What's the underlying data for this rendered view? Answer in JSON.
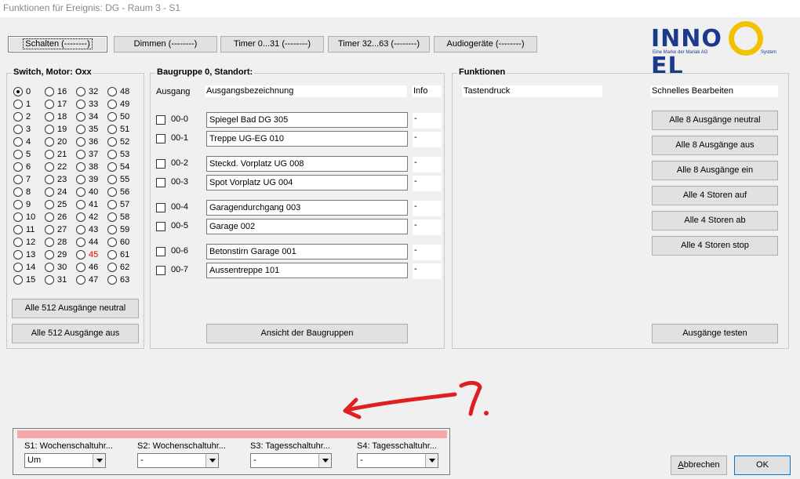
{
  "window": {
    "title": "Funktionen für Ereignis: DG - Raum 3 - S1"
  },
  "tabs": [
    {
      "label": "Schalten (--------)"
    },
    {
      "label": "Dimmen (--------)"
    },
    {
      "label": "Timer 0...31 (--------)"
    },
    {
      "label": "Timer 32...63 (--------)"
    },
    {
      "label": "Audiogeräte (--------)"
    }
  ],
  "logo": {
    "text_left": "INNO",
    "text_right": "EL",
    "tagline": "Eine Marke der Mariak AG",
    "system": "System",
    "colors": {
      "blue": "#1a3a8c",
      "yellow": "#f2c200"
    }
  },
  "switch_group": {
    "title": "Switch, Motor: Oxx",
    "selected": "0",
    "highlighted": "45",
    "columns": [
      [
        "0",
        "1",
        "2",
        "3",
        "4",
        "5",
        "6",
        "7",
        "8",
        "9",
        "10",
        "11",
        "12",
        "13",
        "14",
        "15"
      ],
      [
        "16",
        "17",
        "18",
        "19",
        "20",
        "21",
        "22",
        "23",
        "24",
        "25",
        "26",
        "27",
        "28",
        "29",
        "30",
        "31"
      ],
      [
        "32",
        "33",
        "34",
        "35",
        "36",
        "37",
        "38",
        "39",
        "40",
        "41",
        "42",
        "43",
        "44",
        "45",
        "46",
        "47"
      ],
      [
        "48",
        "49",
        "50",
        "51",
        "52",
        "53",
        "54",
        "55",
        "56",
        "57",
        "58",
        "59",
        "60",
        "61",
        "62",
        "63"
      ]
    ],
    "btn_neutral": "Alle 512 Ausgänge neutral",
    "btn_off": "Alle 512 Ausgänge aus"
  },
  "baugruppe": {
    "title": "Baugruppe 0, Standort:",
    "col_ausgang": "Ausgang",
    "col_bezeichnung": "Ausgangsbezeichnung",
    "col_info": "Info",
    "outputs": [
      {
        "id": "00-0",
        "name": "Spiegel Bad DG  305",
        "info": "-"
      },
      {
        "id": "00-1",
        "name": "Treppe UG-EG  010",
        "info": "-"
      },
      {
        "id": "00-2",
        "name": "Steckd. Vorplatz UG  008",
        "info": "-"
      },
      {
        "id": "00-3",
        "name": "Spot Vorplatz UG  004",
        "info": "-"
      },
      {
        "id": "00-4",
        "name": "Garagendurchgang  003",
        "info": "-"
      },
      {
        "id": "00-5",
        "name": "Garage  002",
        "info": "-"
      },
      {
        "id": "00-6",
        "name": "Betonstirn Garage  001",
        "info": "-"
      },
      {
        "id": "00-7",
        "name": "Aussentreppe  101",
        "info": "-"
      }
    ],
    "btn_view": "Ansicht der Baugruppen"
  },
  "funktionen": {
    "title": "Funktionen",
    "col_left": "Tastendruck",
    "col_right": "Schnelles Bearbeiten",
    "buttons": [
      "Alle 8 Ausgänge neutral",
      "Alle 8 Ausgänge aus",
      "Alle 8 Ausgänge ein",
      "Alle 4 Storen auf",
      "Alle 4 Storen ab",
      "Alle 4 Storen stop"
    ],
    "btn_test": "Ausgänge testen"
  },
  "schedules": [
    {
      "label": "S1: Wochenschaltuhr...",
      "value": "Um"
    },
    {
      "label": "S2: Wochenschaltuhr...",
      "value": "-"
    },
    {
      "label": "S3: Tagesschaltuhr...",
      "value": "-"
    },
    {
      "label": "S4: Tagesschaltuhr...",
      "value": "-"
    }
  ],
  "footer": {
    "cancel": "Abbrechen",
    "ok": "OK"
  },
  "annotation": {
    "color": "#e02020"
  }
}
